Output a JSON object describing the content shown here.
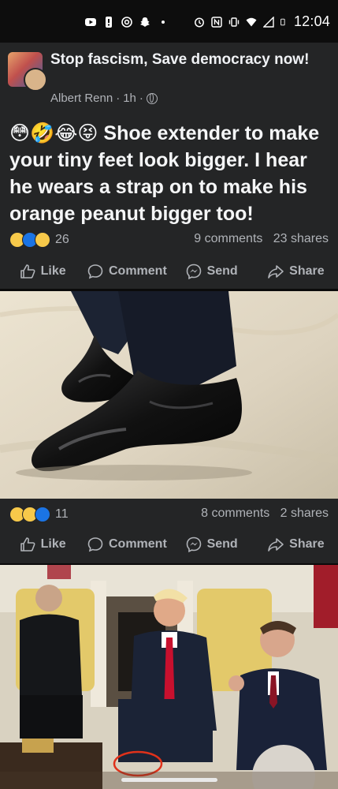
{
  "status_bar": {
    "time": "12:04",
    "icons": [
      "youtube-icon",
      "notification-icon",
      "threads-icon",
      "snapchat-icon",
      "dot-icon",
      "alarm-icon",
      "nfc-icon",
      "vibrate-icon",
      "wifi-icon",
      "signal-icon",
      "battery-icon"
    ]
  },
  "post": {
    "group_name": "Stop fascism, Save democracy now!",
    "author": "Albert Renn",
    "time": "1h",
    "visibility_icon": "globe-icon",
    "emojis": "😳🤣😂😝",
    "text": "Shoe extender to make your tiny feet look bigger. I hear he wears a strap on to make his orange peanut bigger too!",
    "reaction_count": "26",
    "comments": "9 comments",
    "shares": "23 shares"
  },
  "photo_post": {
    "reaction_count": "11",
    "comments": "8 comments",
    "shares": "2 shares"
  },
  "actions": {
    "like": "Like",
    "comment": "Comment",
    "send": "Send",
    "share": "Share"
  },
  "colors": {
    "card_bg": "#242526",
    "text_primary": "#e4e6eb",
    "text_secondary": "#b0b3b8",
    "reaction_like": "#1b74e4",
    "reaction_emoji": "#f7c94a"
  }
}
